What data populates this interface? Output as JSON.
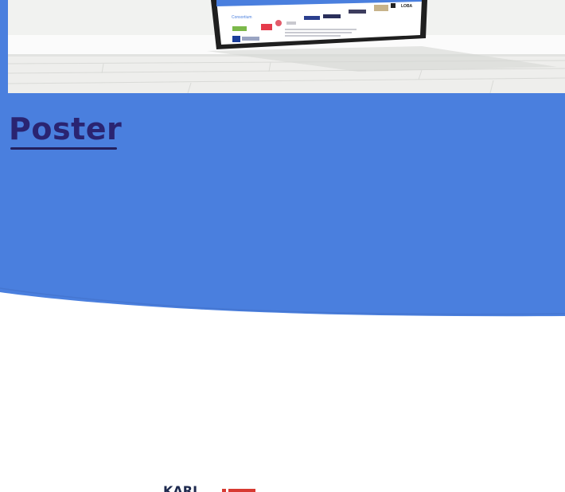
{
  "section": {
    "title": "Poster"
  },
  "poster": {
    "consortium_label": "Consortium",
    "logos": [
      "LOBA"
    ]
  },
  "footer_logo": {
    "text": "KARL"
  },
  "colors": {
    "blue_band": "#4a7fde",
    "title": "#2a2471",
    "frame": "#1e1e1e"
  }
}
